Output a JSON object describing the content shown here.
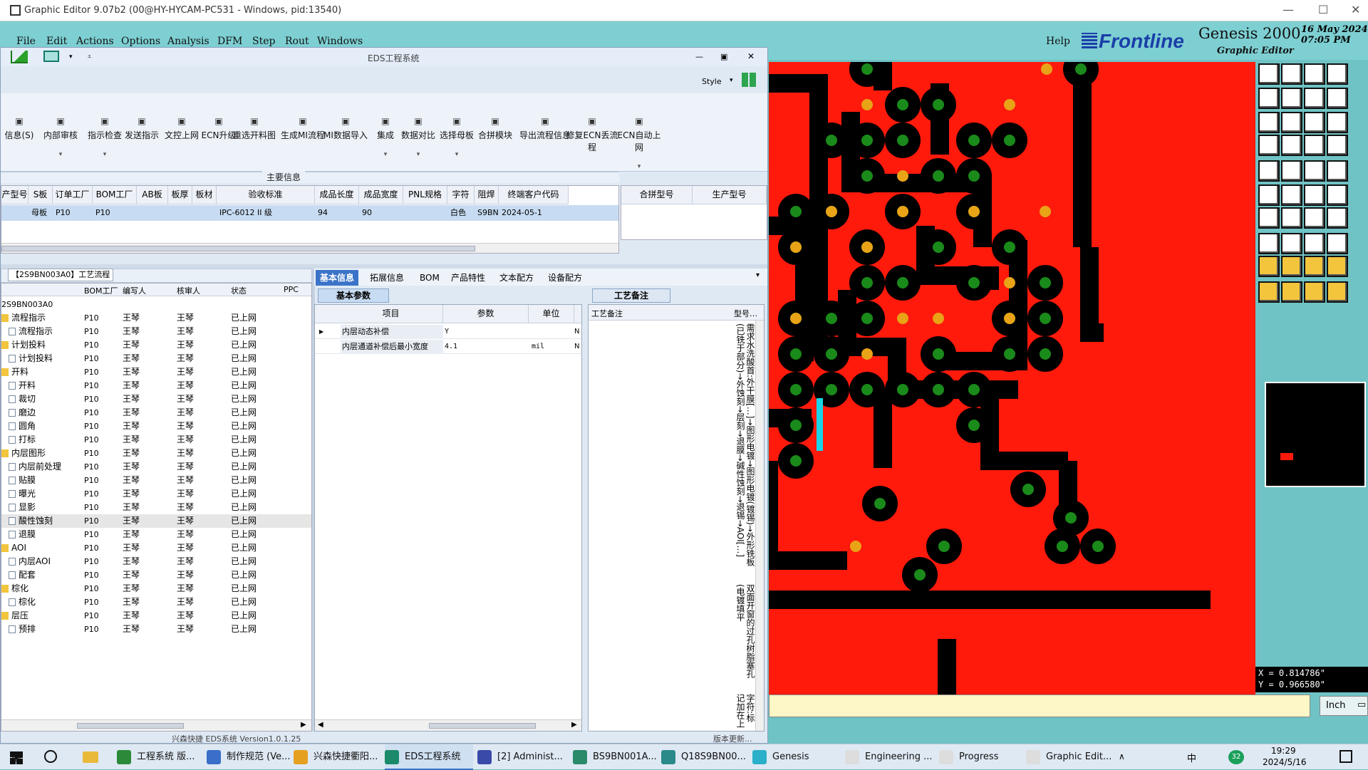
{
  "genesis": {
    "title": "Graphic Editor 9.07b2 (00@HY-HYCAM-PC531 - Windows, pid:13540)",
    "menu": [
      "File",
      "Edit",
      "Actions",
      "Options",
      "Analysis",
      "DFM",
      "Step",
      "Rout",
      "Windows"
    ],
    "help": "Help",
    "brand": "Frontline",
    "product": "Genesis 2000",
    "subtitle": "Graphic Editor",
    "date": "16 May 2024",
    "time": "07:05 PM",
    "x_coord": "X = 0.814786\"",
    "y_coord": "Y = 0.966580\"",
    "units": "Inch"
  },
  "eds": {
    "title": "EDS工程系统",
    "style_label": "Style",
    "ribbon": [
      "信息(S)",
      "内部审核",
      "指示检查",
      "发送指示",
      "文控上网",
      "ECN升级",
      "重选开料图",
      "生成MI流程",
      "MI数据导入",
      "集成",
      "数据对比",
      "选择母板",
      "合拼模块",
      "导出流程信息",
      "修复ECN丢流程",
      "ECN自动上网"
    ],
    "main_info_label": "主要信息",
    "main_columns": [
      "产型号",
      "S板",
      "订单工厂",
      "BOM工厂",
      "AB板",
      "板厚",
      "板材",
      "验收标准",
      "成品长度",
      "成品宽度",
      "PNL规格",
      "字符",
      "阻焊",
      "终端客户代码"
    ],
    "main_row": [
      "",
      "母板",
      "P10",
      "P10",
      "",
      "",
      "",
      "IPC-6012 II 级",
      "94",
      "90",
      "",
      "白色",
      "S9BN",
      "2024-05-1"
    ],
    "side_columns": [
      "合拼型号",
      "生产型号"
    ],
    "tree_title": "【2S9BN003A0】工艺流程",
    "tree_columns": [
      "BOM工厂",
      "编写人",
      "核审人",
      "状态",
      "PPC"
    ],
    "tree_root": "2S9BN003A0",
    "tree_rows": [
      {
        "name": "流程指示",
        "level": 0,
        "folder": true
      },
      {
        "name": "流程指示",
        "level": 1,
        "folder": false
      },
      {
        "name": "计划投料",
        "level": 0,
        "folder": true
      },
      {
        "name": "计划投料",
        "level": 1,
        "folder": false
      },
      {
        "name": "开料",
        "level": 0,
        "folder": true
      },
      {
        "name": "开料",
        "level": 1,
        "folder": false
      },
      {
        "name": "裁切",
        "level": 1,
        "folder": false
      },
      {
        "name": "磨边",
        "level": 1,
        "folder": false
      },
      {
        "name": "圆角",
        "level": 1,
        "folder": false
      },
      {
        "name": "打标",
        "level": 1,
        "folder": false
      },
      {
        "name": "内层图形",
        "level": 0,
        "folder": true
      },
      {
        "name": "内层前处理",
        "level": 1,
        "folder": false
      },
      {
        "name": "贴膜",
        "level": 1,
        "folder": false
      },
      {
        "name": "曝光",
        "level": 1,
        "folder": false
      },
      {
        "name": "显影",
        "level": 1,
        "folder": false
      },
      {
        "name": "酸性蚀刻",
        "level": 1,
        "folder": false
      },
      {
        "name": "退膜",
        "level": 1,
        "folder": false
      },
      {
        "name": "AOI",
        "level": 0,
        "folder": true
      },
      {
        "name": "内层AOI",
        "level": 1,
        "folder": false
      },
      {
        "name": "配套",
        "level": 1,
        "folder": false
      },
      {
        "name": "棕化",
        "level": 0,
        "folder": true
      },
      {
        "name": "棕化",
        "level": 1,
        "folder": false
      },
      {
        "name": "层压",
        "level": 0,
        "folder": true
      },
      {
        "name": "预排",
        "level": 1,
        "folder": false
      }
    ],
    "tree_cell": {
      "factory": "P10",
      "writer": "王琴",
      "checker": "王琴",
      "status": "已上网"
    },
    "tabs": [
      "基本信息",
      "拓展信息",
      "BOM",
      "产品特性",
      "文本配方",
      "设备配方"
    ],
    "basic_tab": "基本参数",
    "basic_columns": [
      "项目",
      "参数",
      "单位"
    ],
    "basic_rows": [
      {
        "item": "内层动态补偿",
        "param": "Y",
        "unit": "",
        "flag": "N"
      },
      {
        "item": "内层通道补偿后最小宽度",
        "param": "4.1",
        "unit": "mil",
        "flag": "N"
      }
    ],
    "process_tab": "工艺备注",
    "process_col": "工艺备注",
    "process_col2": "型号…",
    "process_note_1": "需求水洗酸首:外干膜[…]→图形电镀→图形电镀(镀锡)→外形铣板(已铣于部分)→外蚀刻→层刻→退膜→碱性蚀刻→退锡→AOI[…]",
    "process_note_2": "双面开窗的过孔树脂塞孔(电镀填平",
    "process_note_3": "字符:标记加在上边",
    "footer_left": "兴森快捷 EDS系统 Version1.0.1.25",
    "footer_right": "版本更新..."
  },
  "taskbar": {
    "items": [
      "工程系统  版...",
      "制作规范 (Ve...",
      "兴森快捷衢阳...",
      "EDS工程系统",
      "[2] Administ...",
      "BS9BN001A...",
      "Q18S9BN00...",
      "Genesis",
      "Engineering ...",
      "Progress",
      "Graphic Edit..."
    ],
    "ime": "中",
    "badge": "32",
    "clock_time": "19:29",
    "clock_date": "2024/5/16"
  },
  "colors": {
    "copper": "#ff1a0c",
    "pad": "#000000",
    "drill": "#1a8a1a",
    "via": "#e8a317"
  }
}
